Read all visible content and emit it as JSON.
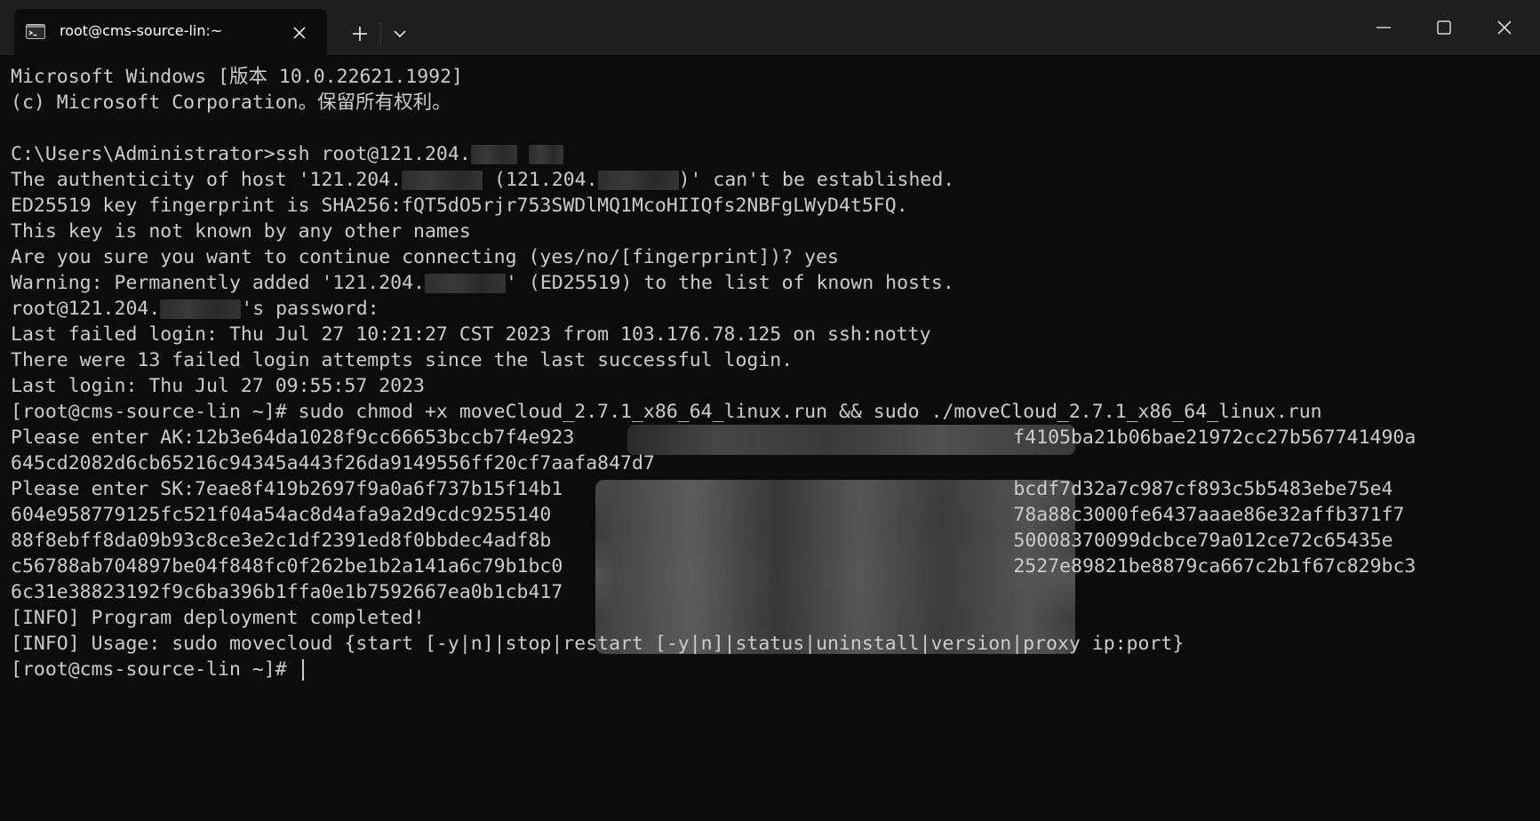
{
  "tab": {
    "title": "root@cms-source-lin:~",
    "icon": "terminal-icon"
  },
  "titlebar": {
    "new_tab_icon": "plus-icon",
    "dropdown_icon": "chevron-down-icon"
  },
  "window_controls": {
    "minimize_icon": "minimize-icon",
    "maximize_icon": "maximize-icon",
    "close_icon": "close-icon"
  },
  "terminal": {
    "lines": [
      {
        "segments": [
          {
            "t": "Microsoft Windows [版本 10.0.22621.1992]"
          }
        ]
      },
      {
        "segments": [
          {
            "t": "(c) Microsoft Corporation。保留所有权利。"
          }
        ]
      },
      {
        "segments": [
          {
            "t": ""
          }
        ]
      },
      {
        "segments": [
          {
            "t": "C:\\Users\\Administrator>ssh root@121.204."
          },
          {
            "redacted": 4
          },
          {
            "t": " "
          },
          {
            "redacted": 3
          }
        ]
      },
      {
        "segments": [
          {
            "t": "The authenticity of host '121.204."
          },
          {
            "redacted": 7
          },
          {
            "t": " (121.204."
          },
          {
            "redacted": 7
          },
          {
            "t": ")' can't be established."
          }
        ]
      },
      {
        "segments": [
          {
            "t": "ED25519 key fingerprint is SHA256:fQT5dO5rjr753SWDlMQ1McoHIIQfs2NBFgLWyD4t5FQ."
          }
        ]
      },
      {
        "segments": [
          {
            "t": "This key is not known by any other names"
          }
        ]
      },
      {
        "segments": [
          {
            "t": "Are you sure you want to continue connecting (yes/no/[fingerprint])? yes"
          }
        ]
      },
      {
        "segments": [
          {
            "t": "Warning: Permanently added '121.204."
          },
          {
            "redacted": 7
          },
          {
            "t": "' (ED25519) to the list of known hosts."
          }
        ]
      },
      {
        "segments": [
          {
            "t": "root@121.204."
          },
          {
            "redacted": 7
          },
          {
            "t": "'s password:"
          }
        ]
      },
      {
        "segments": [
          {
            "t": "Last failed login: Thu Jul 27 10:21:27 CST 2023 from 103.176.78.125 on ssh:notty"
          }
        ]
      },
      {
        "segments": [
          {
            "t": "There were 13 failed login attempts since the last successful login."
          }
        ]
      },
      {
        "segments": [
          {
            "t": "Last login: Thu Jul 27 09:55:57 2023"
          }
        ]
      },
      {
        "segments": [
          {
            "t": "[root@cms-source-lin ~]# sudo chmod +x moveCloud_2.7.1_x86_64_linux.run && sudo ./moveCloud_2.7.1_x86_64_linux.run"
          }
        ]
      },
      {
        "segments": [
          {
            "t": "Please enter AK:12b3e64da1028f9cc66653bccb7f4e923"
          },
          {
            "spacer": 38
          },
          {
            "t": "f4105ba21b06bae21972cc27b567741490a"
          }
        ]
      },
      {
        "segments": [
          {
            "t": "645cd2082d6cb65216c94345a443f26da9149556ff20cf7aafa847d7"
          }
        ]
      },
      {
        "segments": [
          {
            "t": "Please enter SK:7eae8f419b2697f9a0a6f737b15f14b1"
          },
          {
            "spacer": 39
          },
          {
            "t": "bcdf7d32a7c987cf893c5b5483ebe75e4"
          }
        ]
      },
      {
        "segments": [
          {
            "t": "604e958779125fc521f04a54ac8d4afa9a2d9cdc9255140"
          },
          {
            "spacer": 40
          },
          {
            "t": "78a88c3000fe6437aaae86e32affb371f7"
          }
        ]
      },
      {
        "segments": [
          {
            "t": "88f8ebff8da09b93c8ce3e2c1df2391ed8f0bbdec4adf8b"
          },
          {
            "spacer": 40
          },
          {
            "t": "50008370099dcbce79a012ce72c65435e"
          }
        ]
      },
      {
        "segments": [
          {
            "t": "c56788ab704897be04f848fc0f262be1b2a141a6c79b1bc0"
          },
          {
            "spacer": 39
          },
          {
            "t": "2527e89821be8879ca667c2b1f67c829bc3"
          }
        ]
      },
      {
        "segments": [
          {
            "t": "6c31e38823192f9c6ba396b1ffa0e1b7592667ea0b1cb417"
          }
        ]
      },
      {
        "segments": [
          {
            "t": "[INFO] Program deployment completed!"
          }
        ]
      },
      {
        "segments": [
          {
            "t": "[INFO] Usage: sudo movecloud {start [-y|n]|stop|restart [-y|n]|status|uninstall|version|proxy ip:port}"
          }
        ]
      },
      {
        "segments": [
          {
            "t": "[root@cms-source-lin ~]# "
          }
        ],
        "cursor": true
      }
    ]
  },
  "colors": {
    "background": "#0c0c0c",
    "titlebar": "#1f1f1f",
    "text": "#cccccc"
  }
}
